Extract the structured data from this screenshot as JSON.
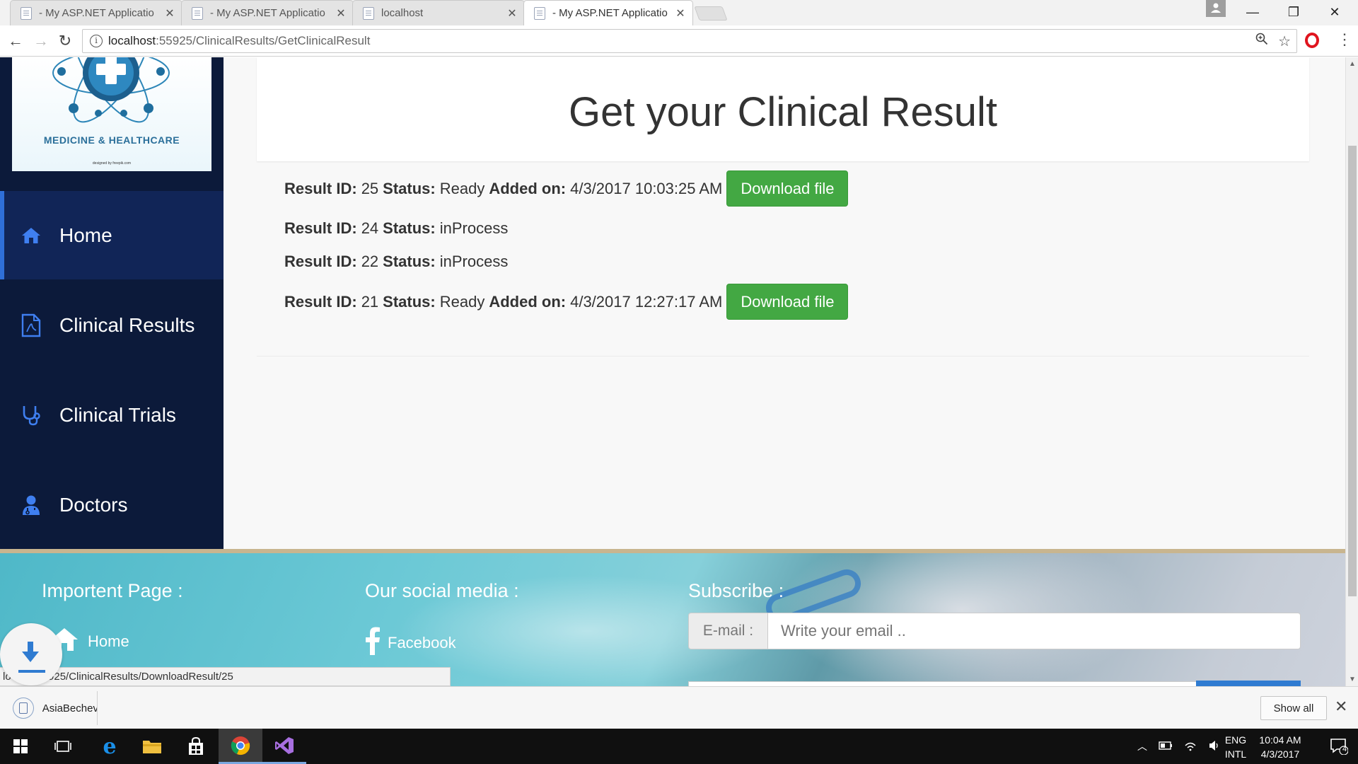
{
  "browser": {
    "tabs": [
      {
        "title": "- My ASP.NET Applicatio"
      },
      {
        "title": "- My ASP.NET Applicatio"
      },
      {
        "title": "localhost"
      },
      {
        "title": "- My ASP.NET Applicatio"
      }
    ],
    "url_host": "localhost",
    "url_path": ":55925/ClinicalResults/GetClinicalResult"
  },
  "logo": {
    "title": "MEDICINE & HEALTHCARE",
    "credit": "designed by freepik.com"
  },
  "sidebar": {
    "items": [
      {
        "label": "Home",
        "icon": "home-icon"
      },
      {
        "label": "Clinical Results",
        "icon": "pdf-file-icon"
      },
      {
        "label": "Clinical Trials",
        "icon": "stethoscope-icon"
      },
      {
        "label": "Doctors",
        "icon": "doctor-icon"
      }
    ]
  },
  "main": {
    "heading": "Get your Clinical Result",
    "labels": {
      "result_id": "Result ID:",
      "status": "Status:",
      "added_on": "Added on:"
    },
    "download_label": "Download file",
    "results": [
      {
        "id": "25",
        "status": "Ready",
        "added_on": "4/3/2017 10:03:25 AM",
        "downloadable": true
      },
      {
        "id": "24",
        "status": "inProcess",
        "added_on": "",
        "downloadable": false
      },
      {
        "id": "22",
        "status": "inProcess",
        "added_on": "",
        "downloadable": false
      },
      {
        "id": "21",
        "status": "Ready",
        "added_on": "4/3/2017 12:27:17 AM",
        "downloadable": true
      }
    ]
  },
  "footer": {
    "important_title": "Importent Page :",
    "home_link": "Home",
    "social_title": "Our social media :",
    "facebook_link": "Facebook",
    "subscribe_title": "Subscribe :",
    "email_label": "E-mail :",
    "email_placeholder": "Write your email .."
  },
  "status_bar": {
    "link": "lo",
    "link_rest": "5925/ClinicalResults/DownloadResult/25"
  },
  "downloads": {
    "item_name": "AsiaBechev",
    "show_all": "Show all"
  },
  "taskbar": {
    "lang_top": "ENG",
    "lang_bottom": "INTL",
    "time": "10:04 AM",
    "date": "4/3/2017",
    "notifications": "4"
  },
  "colors": {
    "sidebar_bg": "#0c1a3a",
    "accent_blue": "#2f6fd8",
    "download_green": "#43a843"
  }
}
